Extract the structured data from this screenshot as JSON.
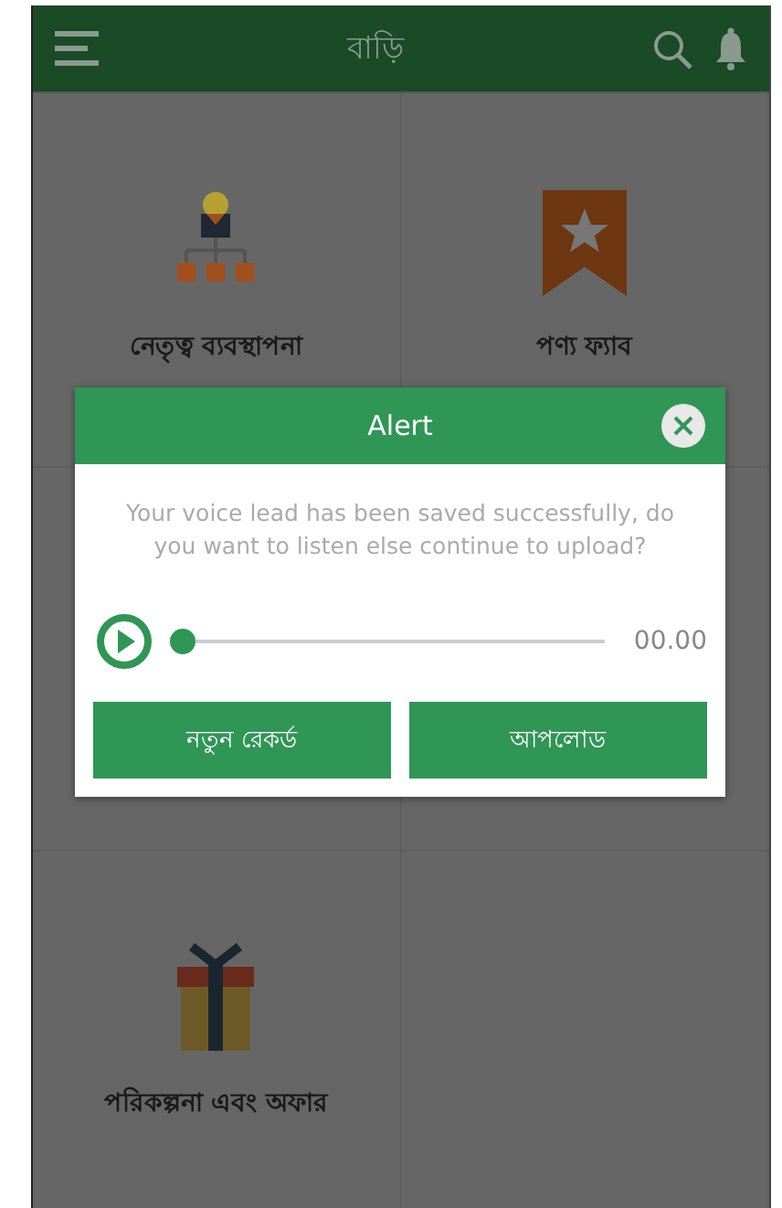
{
  "header": {
    "title": "বাড়ি"
  },
  "tiles": [
    {
      "label": "নেতৃত্ব ব্যবস্থাপনা",
      "kind": "org"
    },
    {
      "label": "পণ্য ফ্যাব",
      "kind": "bookmark"
    },
    {
      "kind": "hidden"
    },
    {
      "kind": "hidden"
    },
    {
      "label": "পরিকল্পনা এবং অফার",
      "kind": "gift"
    },
    {
      "kind": "empty"
    }
  ],
  "alert": {
    "title": "Alert",
    "message": "Your voice lead has been saved successfully, do you want to listen else continue to upload?",
    "player": {
      "level": 0,
      "time": "00.00"
    },
    "buttons": [
      "নতুন রেকর্ড",
      "আপলোড"
    ]
  }
}
